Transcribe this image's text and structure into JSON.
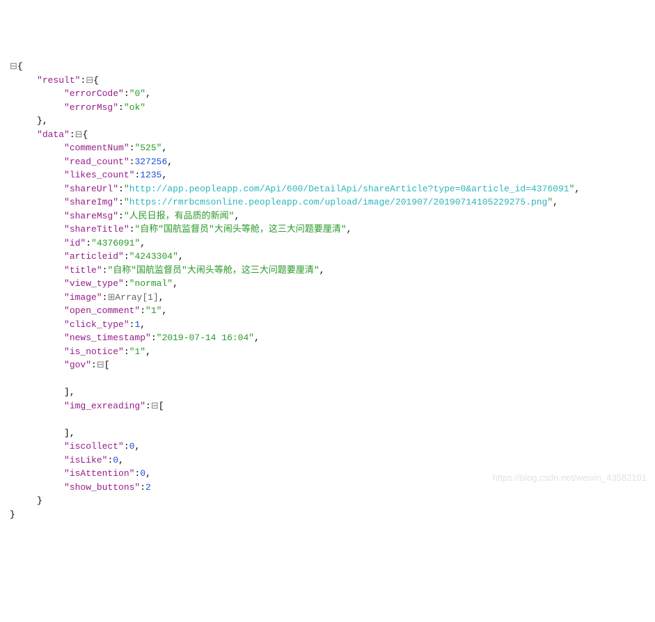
{
  "icons": {
    "collapse": "⊟",
    "expand": "⊞"
  },
  "root": {
    "result": {
      "errorCode": "\"0\"",
      "errorMsg": "\"ok\""
    },
    "data": {
      "commentNum": "\"525\"",
      "read_count": "327256",
      "likes_count": "1235",
      "shareUrl_key": "\"shareUrl\"",
      "shareUrl_val": "http://app.peopleapp.com/Api/600/DetailApi/shareArticle?type=0&article_id=4376091",
      "shareImg_key": "\"shareImg\"",
      "shareImg_val": "https://rmrbcmsonline.peopleapp.com/upload/image/201907/20190714105229275.png",
      "shareMsg": "\"人民日报，有品质的新闻\"",
      "shareTitle": "\"自称\"国航监督员\"大闹头等舱，这三大问题要厘清\"",
      "id": "\"4376091\"",
      "articleid": "\"4243304\"",
      "title": "\"自称\"国航监督员\"大闹头等舱，这三大问题要厘清\"",
      "view_type": "\"normal\"",
      "image_label": "Array[1]",
      "open_comment": "\"1\"",
      "click_type": "1",
      "news_timestamp": "\"2019-07-14 16:04\"",
      "is_notice": "\"1\"",
      "iscollect": "0",
      "isLike": "0",
      "isAttention": "0",
      "show_buttons": "2"
    }
  },
  "keys": {
    "result": "\"result\"",
    "errorCode": "\"errorCode\"",
    "errorMsg": "\"errorMsg\"",
    "data": "\"data\"",
    "commentNum": "\"commentNum\"",
    "read_count": "\"read_count\"",
    "likes_count": "\"likes_count\"",
    "shareMsg": "\"shareMsg\"",
    "shareTitle": "\"shareTitle\"",
    "id": "\"id\"",
    "articleid": "\"articleid\"",
    "title": "\"title\"",
    "view_type": "\"view_type\"",
    "image": "\"image\"",
    "open_comment": "\"open_comment\"",
    "click_type": "\"click_type\"",
    "news_timestamp": "\"news_timestamp\"",
    "is_notice": "\"is_notice\"",
    "gov": "\"gov\"",
    "img_exreading": "\"img_exreading\"",
    "iscollect": "\"iscollect\"",
    "isLike": "\"isLike\"",
    "isAttention": "\"isAttention\"",
    "show_buttons": "\"show_buttons\""
  },
  "watermark": "https://blog.csdn.net/weixin_43582101"
}
